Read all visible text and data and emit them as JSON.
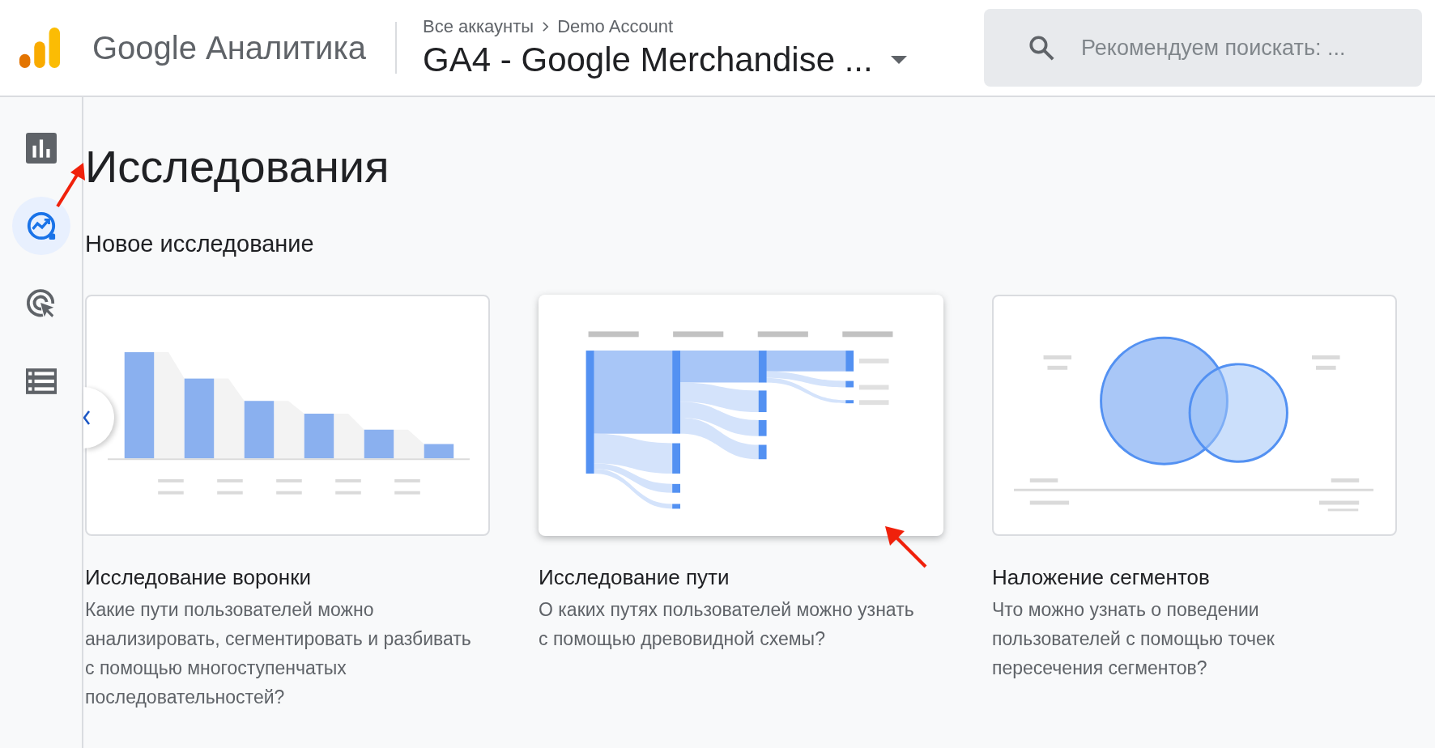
{
  "header": {
    "product": "Google Аналитика",
    "breadcrumb": [
      "Все аккаунты",
      "Demo Account"
    ],
    "property": "GA4 - Google Merchandise ...",
    "search": {
      "placeholder": "Рекомендуем поискать: ..."
    }
  },
  "sidebar": {
    "items": [
      {
        "kind": "reports",
        "selected": false
      },
      {
        "kind": "explore",
        "selected": true
      },
      {
        "kind": "advertising",
        "selected": false
      },
      {
        "kind": "configure",
        "selected": false
      }
    ]
  },
  "page": {
    "title": "Исследования",
    "section": "Новое исследование",
    "cards": [
      {
        "kind": "funnel",
        "selected": false,
        "title": "Исследование воронки",
        "description": "Какие пути пользователей можно анализировать, сегментировать и разбивать с помощью многоступенчатых последовательностей?"
      },
      {
        "kind": "path",
        "selected": true,
        "title": "Исследование пути",
        "description": "О каких путях пользователей можно узнать с помощью древовидной схемы?"
      },
      {
        "kind": "overlap",
        "selected": false,
        "title": "Наложение сегментов",
        "description": "Что можно узнать о поведении пользователей с помощью точек пересечения сегментов?"
      }
    ]
  }
}
